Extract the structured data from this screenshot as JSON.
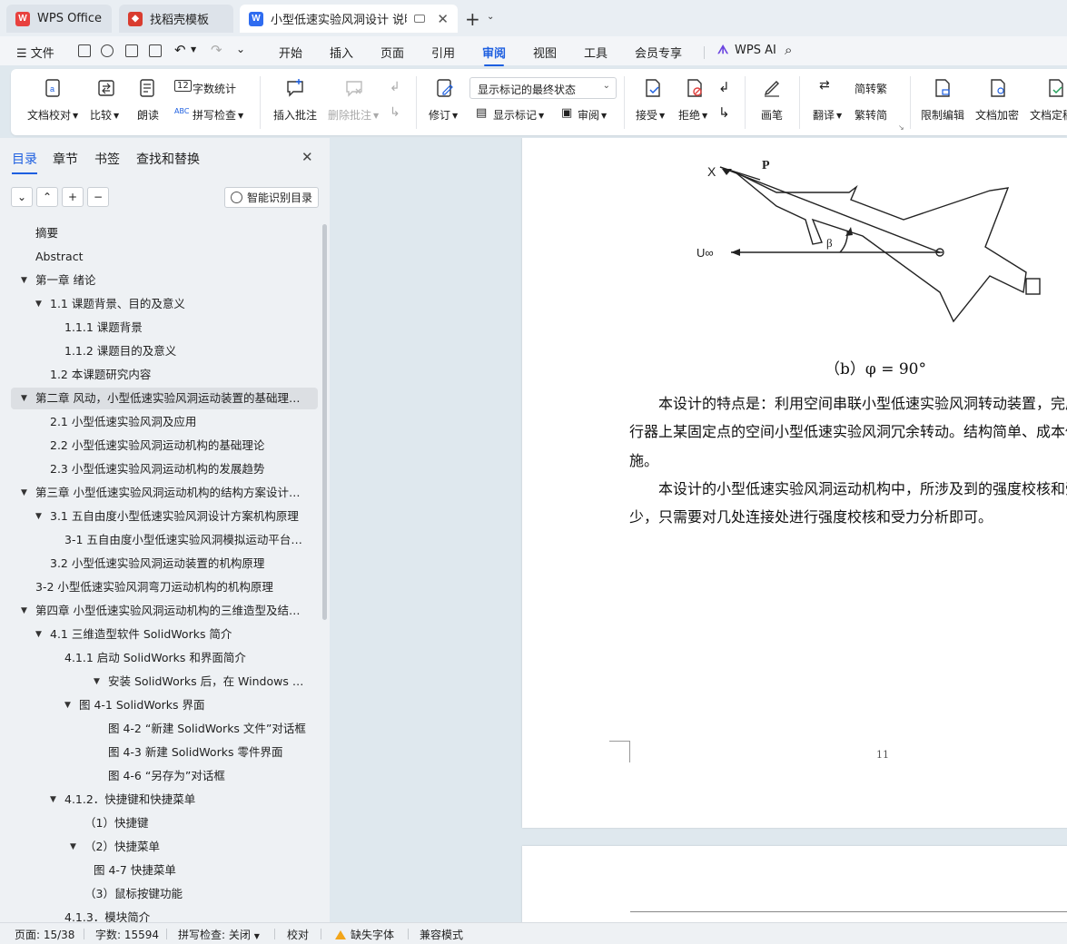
{
  "tabs": [
    {
      "label": "WPS Office"
    },
    {
      "label": "找稻壳模板"
    },
    {
      "label": "小型低速实验风洞设计 说明书"
    }
  ],
  "menu": {
    "file": "文件",
    "items": [
      "开始",
      "插入",
      "页面",
      "引用",
      "审阅",
      "视图",
      "工具",
      "会员专享"
    ],
    "active": "审阅",
    "ai": "WPS AI"
  },
  "ribbon": {
    "doc_proofread": "文档校对",
    "compare": "比较",
    "read_aloud": "朗读",
    "word_count": "字数统计",
    "spell_check": "拼写检查",
    "insert_comment": "插入批注",
    "delete_comment": "删除批注",
    "revise": "修订",
    "markup_state": "显示标记的最终状态",
    "show_markup": "显示标记",
    "review": "审阅",
    "accept": "接受",
    "reject": "拒绝",
    "pen": "画笔",
    "translate": "翻译",
    "simp_to_trad": "简转繁",
    "trad_to_simp": "繁转简",
    "restrict_edit": "限制编辑",
    "doc_encrypt": "文档加密",
    "doc_finalize": "文档定稿"
  },
  "nav": {
    "tabs": [
      "目录",
      "章节",
      "书签",
      "查找和替换"
    ],
    "smart_toc": "智能识别目录",
    "toc": [
      {
        "text": "摘要",
        "level": 1,
        "arrow": ""
      },
      {
        "text": "Abstract",
        "level": 1,
        "arrow": ""
      },
      {
        "text": "第一章  绪论",
        "level": 1,
        "arrow": "down"
      },
      {
        "text": "1.1 课题背景、目的及意义",
        "level": 2,
        "arrow": "down"
      },
      {
        "text": "1.1.1 课题背景",
        "level": 3,
        "arrow": ""
      },
      {
        "text": "1.1.2 课题目的及意义",
        "level": 3,
        "arrow": ""
      },
      {
        "text": "1.2 本课题研究内容",
        "level": 2,
        "arrow": ""
      },
      {
        "text": "第二章  风动，小型低速实验风洞运动装置的基础理论 ...",
        "level": 1,
        "arrow": "down",
        "selected": true
      },
      {
        "text": "2.1 小型低速实验风洞及应用",
        "level": 2,
        "arrow": ""
      },
      {
        "text": "2.2 小型低速实验风洞运动机构的基础理论",
        "level": 2,
        "arrow": ""
      },
      {
        "text": "2.3 小型低速实验风洞运动机构的发展趋势",
        "level": 2,
        "arrow": ""
      },
      {
        "text": "第三章  小型低速实验风洞运动机构的结构方案设计和 ...",
        "level": 1,
        "arrow": "down"
      },
      {
        "text": "3.1 五自由度小型低速实验风洞设计方案机构原理",
        "level": 2,
        "arrow": "down"
      },
      {
        "text": "3-1 五自由度小型低速实验风洞模拟运动平台的 ...",
        "level": 3,
        "arrow": ""
      },
      {
        "text": "3.2 小型低速实验风洞运动装置的机构原理",
        "level": 2,
        "arrow": ""
      },
      {
        "text": "3-2 小型低速实验风洞弯刀运动机构的机构原理",
        "level": 1,
        "arrow": ""
      },
      {
        "text": "第四章   小型低速实验风洞运动机构的三维造型及结构 ...",
        "level": 1,
        "arrow": "down"
      },
      {
        "text": "4.1 三维造型软件 SolidWorks 简介",
        "level": 2,
        "arrow": "down"
      },
      {
        "text": "4.1.1 启动 SolidWorks 和界面简介",
        "level": 3,
        "arrow": ""
      },
      {
        "text": "安装 SolidWorks 后，在 Windows 的操 ...",
        "level": 5,
        "arrow": "down"
      },
      {
        "text": "图 4-1    SolidWorks 界面",
        "level": 3.6,
        "arrow": "down"
      },
      {
        "text": "图 4-2   “新建 SolidWorks 文件”对话框",
        "level": 5,
        "arrow": ""
      },
      {
        "text": "图 4-3    新建 SolidWorks 零件界面",
        "level": 5,
        "arrow": ""
      },
      {
        "text": "图 4-6   “另存为”对话框",
        "level": 5,
        "arrow": ""
      },
      {
        "text": "4.1.2．快捷键和快捷菜单",
        "level": 3,
        "arrow": "down"
      },
      {
        "text": "（1）快捷键",
        "level": 4,
        "arrow": ""
      },
      {
        "text": "（2）快捷菜单",
        "level": 4,
        "arrow": "down"
      },
      {
        "text": "图 4-7    快捷菜单",
        "level": 4.6,
        "arrow": ""
      },
      {
        "text": "（3）鼠标按键功能",
        "level": 4,
        "arrow": ""
      },
      {
        "text": "4.1.3．模块简介",
        "level": 3,
        "arrow": ""
      }
    ]
  },
  "document": {
    "figure_labels": {
      "x": "X",
      "p": "P",
      "beta": "β",
      "u": "U∞"
    },
    "caption": "（b）φ = 90°",
    "para1_line1": "本设计的特点是：利用空间串联小型低速实验风洞转动装置，完成",
    "para1_line2": "行器上某固定点的空间小型低速实验风洞冗余转动。结构简单、成本低",
    "para1_line3": "施。",
    "para2_line1": "本设计的小型低速实验风洞运动机构中，所涉及到的强度校核和受",
    "para2_line2": "少，只需要对几处连接处进行强度校核和受力分析即可。",
    "page_number": "11"
  },
  "status": {
    "page": "页面: 15/38",
    "words": "字数: 15594",
    "spell": "拼写检查: 关闭",
    "proof": "校对",
    "missing_font": "缺失字体",
    "compat": "兼容模式"
  },
  "colors": {
    "accent": "#1d5fe0",
    "wps_red": "#e8413e",
    "docer_red": "#d93c2f",
    "writer_blue": "#2f6cf0"
  }
}
